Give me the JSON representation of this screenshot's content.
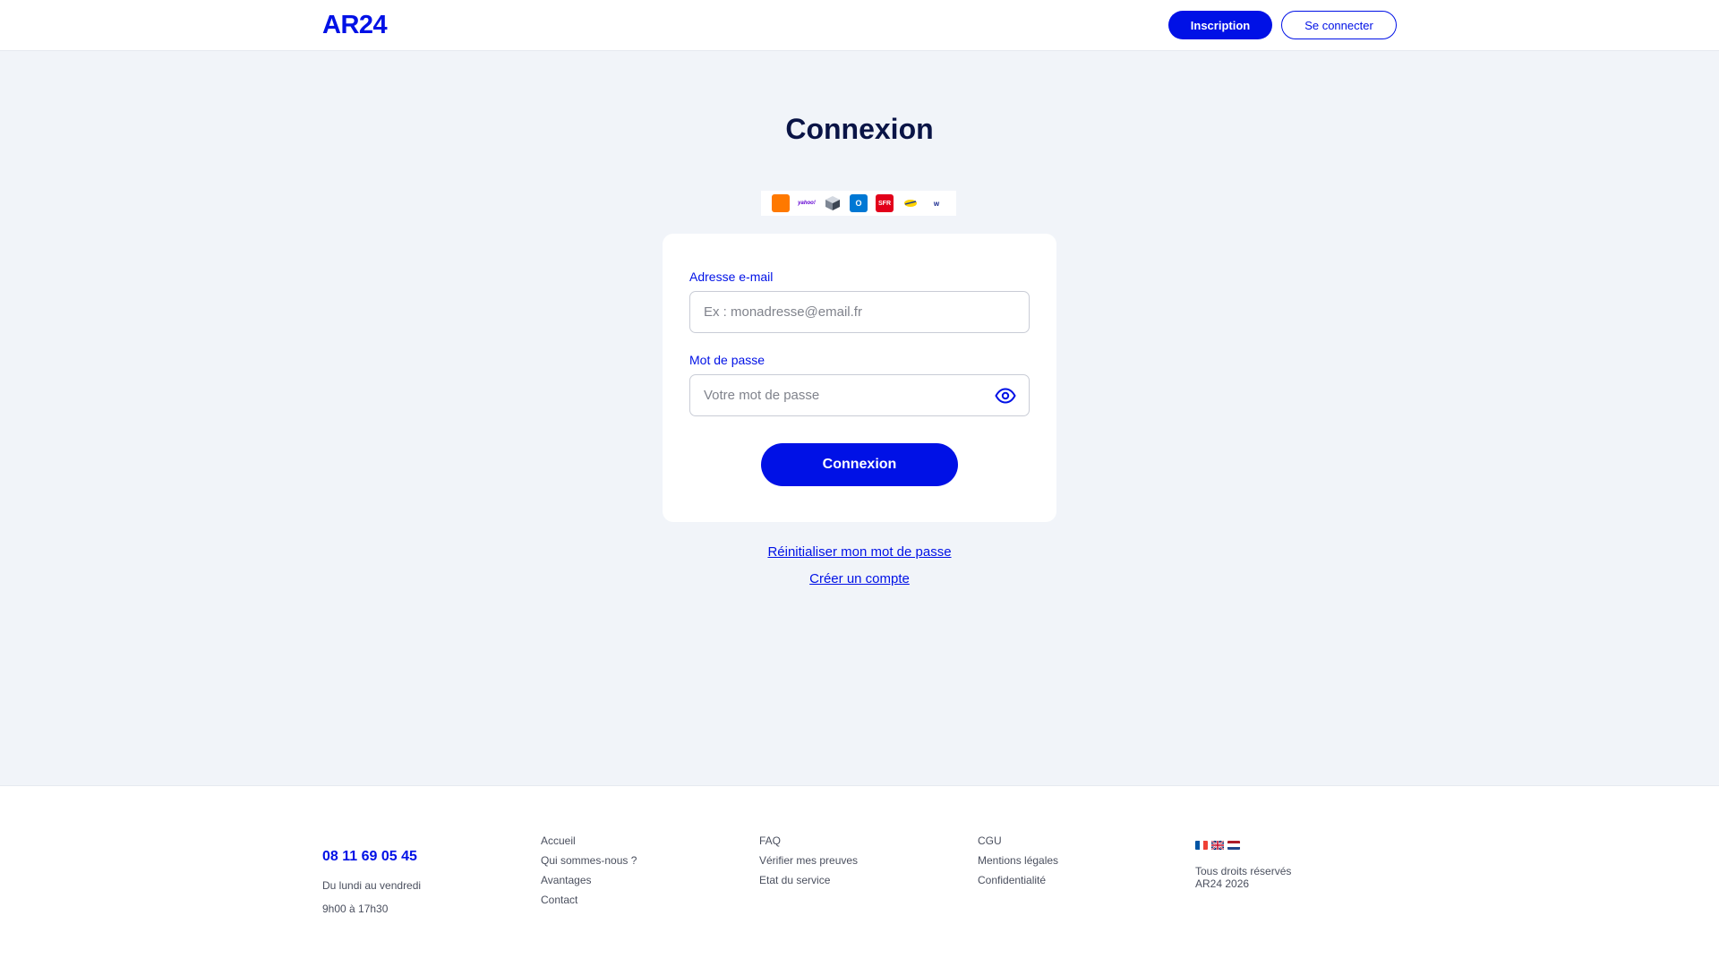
{
  "header": {
    "logo": "AR24",
    "signup_label": "Inscription",
    "login_label": "Se connecter"
  },
  "main": {
    "title": "Connexion",
    "providers": [
      "orange",
      "yahoo",
      "cube",
      "outlook",
      "sfr",
      "laposte",
      "free"
    ],
    "provider_labels": {
      "yahoo": "yahoo!",
      "outlook": "O",
      "sfr": "SFR",
      "free": "w"
    },
    "email_label": "Adresse e-mail",
    "email_placeholder": "Ex : monadresse@email.fr",
    "password_label": "Mot de passe",
    "password_placeholder": "Votre mot de passe",
    "submit_label": "Connexion",
    "reset_link": "Réinitialiser mon mot de passe",
    "create_link": "Créer un compte"
  },
  "footer": {
    "phone": "08 11 69 05 45",
    "days": "Du lundi au vendredi",
    "hours": "9h00 à 17h30",
    "col1": [
      "Accueil",
      "Qui sommes-nous ?",
      "Avantages",
      "Contact"
    ],
    "col2": [
      "FAQ",
      "Vérifier mes preuves",
      "Etat du service"
    ],
    "col3": [
      "CGU",
      "Mentions légales",
      "Confidentialité"
    ],
    "flags": [
      "fr",
      "gb",
      "nl"
    ],
    "rights_line1": "Tous droits réservés",
    "rights_line2": "AR24 2026"
  },
  "colors": {
    "brand": "#0011e6",
    "title": "#0a1446",
    "background": "#f1f4f9"
  }
}
